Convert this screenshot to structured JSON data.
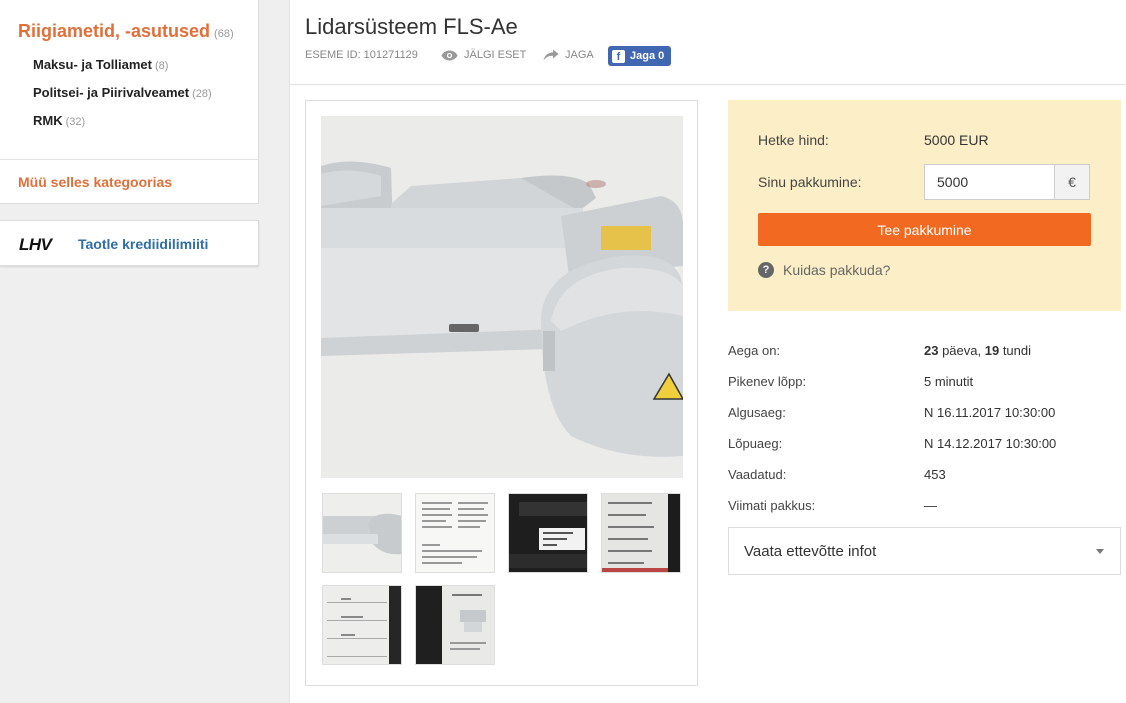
{
  "sidebar": {
    "category": {
      "title": "Riigiametid, -asutused",
      "count": "(68)"
    },
    "subcategories": [
      {
        "label": "Maksu- ja Tolliamet",
        "count": "(8)"
      },
      {
        "label": "Politsei- ja Piirivalveamet",
        "count": "(28)"
      },
      {
        "label": "RMK",
        "count": "(32)"
      }
    ],
    "sell_link": "Müü selles kategoorias",
    "lhv": {
      "logo": "LHV",
      "link": "Taotle krediidilimiiti"
    }
  },
  "item": {
    "title": "Lidarsüsteem FLS-Ae",
    "id_text": "ESEME ID: 101271129",
    "watch_label": "JÄLGI ESET",
    "share_label": "JAGA",
    "fb_share_label": "Jaga 0"
  },
  "bid": {
    "current_price_label": "Hetke hind:",
    "current_price_value": "5000 EUR",
    "your_bid_label": "Sinu pakkumine:",
    "your_bid_value": "5000",
    "currency_symbol": "€",
    "submit_label": "Tee pakkumine",
    "help_label": "Kuidas pakkuda?"
  },
  "details": {
    "time_left_label": "Aega on:",
    "time_left_days": "23",
    "time_left_days_unit": " päeva, ",
    "time_left_hours": "19",
    "time_left_hours_unit": " tundi",
    "extending_end_label": "Pikenev lõpp:",
    "extending_end_value": "5 minutit",
    "start_label": "Algusaeg:",
    "start_value": "N 16.11.2017 10:30:00",
    "end_label": "Lõpuaeg:",
    "end_value": "N 14.12.2017 10:30:00",
    "views_label": "Vaadatud:",
    "views_value": "453",
    "last_bid_label": "Viimati pakkus:",
    "last_bid_value": "—"
  },
  "company": {
    "label": "Vaata ettevõtte infot"
  }
}
